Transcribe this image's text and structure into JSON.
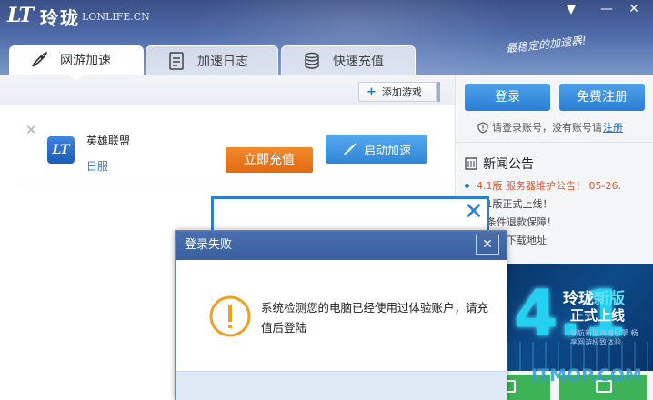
{
  "header": {
    "logo_mark": "LT",
    "logo_cn": "玲珑",
    "logo_url": "LONLIFE.CN",
    "slogan": "最稳定的加速器!",
    "tabs": [
      {
        "label": "网游加速",
        "icon": "rocket-icon",
        "active": true
      },
      {
        "label": "加速日志",
        "icon": "log-icon",
        "active": false
      },
      {
        "label": "快速充值",
        "icon": "coins-icon",
        "active": false
      }
    ],
    "window_controls": {
      "dropdown": "▼",
      "minimize": "—",
      "close": "✕"
    }
  },
  "main": {
    "add_game_label": "添加游戏",
    "games": [
      {
        "icon_text": "LT",
        "name": "英雄联盟",
        "server": "日服",
        "start_label": "启动加速"
      }
    ]
  },
  "sidebar": {
    "login_label": "登录",
    "register_label": "免费注册",
    "hint_text": "请登录账号，没有账号请",
    "hint_link": "注册",
    "news_title": "新闻公告",
    "news": [
      {
        "text": "4.1版 服务器维护公告！ 05-26.",
        "hot": true
      },
      {
        "text": "4.1版正式上线！",
        "hot": false
      },
      {
        "text": "无条件退款保障！",
        "hot": false
      },
      {
        "text": "正式版下载地址",
        "hot": false
      }
    ],
    "banner": {
      "big_number": "4.1",
      "title_a": "玲珑",
      "title_b": "新版",
      "title_line2": "正式上线",
      "small_text": "领航新型高速引擎 畅享网游极致体验"
    }
  },
  "dialog": {
    "title": "登录失败",
    "close": "✕",
    "message": "系统检测您的电脑已经使用过体验账户，请充值后登陆",
    "recharge_label": "立即充值"
  },
  "watermark": "ITMOP.COM",
  "colors": {
    "accent": "#2a7fd3",
    "header": "#4d6aa8",
    "hot": "#e0532a",
    "recharge": "#e06a12"
  }
}
